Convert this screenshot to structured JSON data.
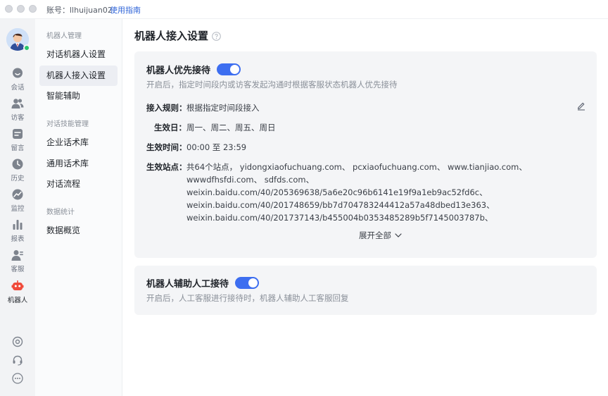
{
  "titlebar": {
    "account": "账号：llhuijuan02",
    "guide_label": "使用指南"
  },
  "rail": {
    "items": [
      {
        "label": "会话",
        "icon": "chat-bubble-icon"
      },
      {
        "label": "访客",
        "icon": "visitors-icon"
      },
      {
        "label": "留言",
        "icon": "message-icon"
      },
      {
        "label": "历史",
        "icon": "clock-icon"
      },
      {
        "label": "监控",
        "icon": "monitor-icon"
      },
      {
        "label": "报表",
        "icon": "bar-chart-icon"
      },
      {
        "label": "客服",
        "icon": "agent-icon"
      },
      {
        "label": "机器人",
        "icon": "robot-icon"
      }
    ],
    "bottom_icons": [
      "target-icon",
      "headset-icon",
      "more-icon"
    ]
  },
  "menu": {
    "group1": "机器人管理",
    "item_dialog_robot": "对话机器人设置",
    "item_robot_access": "机器人接入设置",
    "item_assist": "智能辅助",
    "group2": "对话技能管理",
    "item_enterprise_lib": "企业话术库",
    "item_common_lib": "通用话术库",
    "item_flow": "对话流程",
    "group3": "数据统计",
    "item_overview": "数据概览"
  },
  "page": {
    "title": "机器人接入设置"
  },
  "card1": {
    "title": "机器人优先接待",
    "toggle_on": true,
    "description": "开启后，指定时间段内或访客发起沟通时根据客服状态机器人优先接待",
    "rule_label": "接入规则：",
    "rule_value": "根据指定时间段接入",
    "days_label": "生效日：",
    "days_value": "周一、周二、周五、周日",
    "time_label": "生效时间：",
    "time_value": "00:00 至 23:59",
    "sites_label": "生效站点：",
    "sites_lines": [
      "共64个站点，  yidongxiaofuchuang.com、  pcxiaofuchuang.com、  www.tianjiao.com、",
      "wwwdfhsfdi.com、  sdfds.com、",
      "weixin.baidu.com/40/205369638/5a6e20c96b6141e19f9a1eb9ac52fd6c、",
      "weixin.baidu.com/40/201748659/bb7d704783244412a57a48dbed13e363、",
      "weixin.baidu.com/40/201737143/b455004b0353485289b5f7145003787b、"
    ],
    "expand_label": "展开全部"
  },
  "card2": {
    "title": "机器人辅助人工接待",
    "toggle_on": true,
    "description": "开启后，人工客服进行接待时，机器人辅助人工客服回复"
  },
  "colors": {
    "accent": "#3d6ef0",
    "link": "#2f64d8",
    "robot_icon": "#f04a3a",
    "online": "#27c46b"
  }
}
